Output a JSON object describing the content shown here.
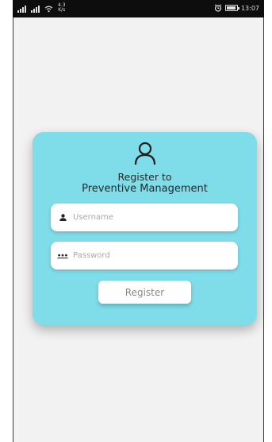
{
  "status_bar": {
    "network_speed_value": "4.3",
    "network_speed_unit": "K/s",
    "time": "13:07",
    "battery_level": 0.9,
    "icons": [
      "signal-icon",
      "signal-icon",
      "wifi-icon",
      "alarm-icon",
      "battery-icon"
    ]
  },
  "form": {
    "icon": "user-icon",
    "title_line1": "Register to",
    "title_line2": "Preventive Management",
    "username_placeholder": "Username",
    "password_placeholder": "Password",
    "register_label": "Register",
    "card_color": "#7fdce9"
  }
}
